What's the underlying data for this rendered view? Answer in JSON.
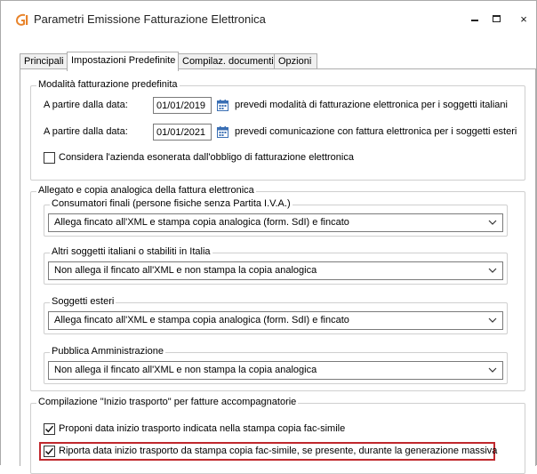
{
  "window": {
    "title": "Parametri Emissione Fatturazione Elettronica",
    "minimize_glyph": "",
    "close_glyph": "×"
  },
  "tabs": [
    {
      "label": "Principali",
      "active": false
    },
    {
      "label": "Impostazioni Predefinite",
      "active": true
    },
    {
      "label": "Compilaz. documenti",
      "active": false
    },
    {
      "label": "Opzioni",
      "active": false
    }
  ],
  "modalita": {
    "legend": "Modalità fatturazione predefinita",
    "row1": {
      "label": "A partire dalla data:",
      "date": "01/01/2019",
      "description": "prevedi modalità di fatturazione elettronica per i soggetti italiani"
    },
    "row2": {
      "label": "A partire dalla data:",
      "date": "01/01/2021",
      "description": "prevedi comunicazione con fattura elettronica per i soggetti esteri"
    },
    "esonerata": {
      "label": "Considera l'azienda esonerata dall'obbligo di fatturazione elettronica",
      "checked": false
    }
  },
  "allegato": {
    "legend": "Allegato e copia analogica della fattura elettronica",
    "consumatori": {
      "legend": "Consumatori finali (persone fisiche senza Partita I.V.A.)",
      "selected": "Allega fincato all'XML e stampa copia analogica (form. SdI) e fincato"
    },
    "altri": {
      "legend": "Altri soggetti italiani o stabiliti in Italia",
      "selected": "Non allega il fincato all'XML e non stampa la copia analogica"
    },
    "esteri": {
      "legend": "Soggetti esteri",
      "selected": "Allega fincato all'XML e stampa copia analogica (form. SdI) e fincato"
    },
    "pa": {
      "legend": "Pubblica Amministrazione",
      "selected": "Non allega il fincato all'XML e non stampa la copia analogica"
    }
  },
  "trasporto": {
    "legend": "Compilazione \"Inizio trasporto\" per fatture accompagnatorie",
    "proponi": {
      "label": "Proponi data inizio trasporto indicata nella stampa copia fac-simile",
      "checked": true
    },
    "riporta": {
      "label": "Riporta data inizio trasporto da stampa copia fac-simile, se presente, durante la generazione massiva",
      "checked": true
    }
  },
  "colors": {
    "highlight": "#c0282d",
    "app_icon_orange": "#e8842c",
    "calendar_blue": "#3a6fb4"
  }
}
